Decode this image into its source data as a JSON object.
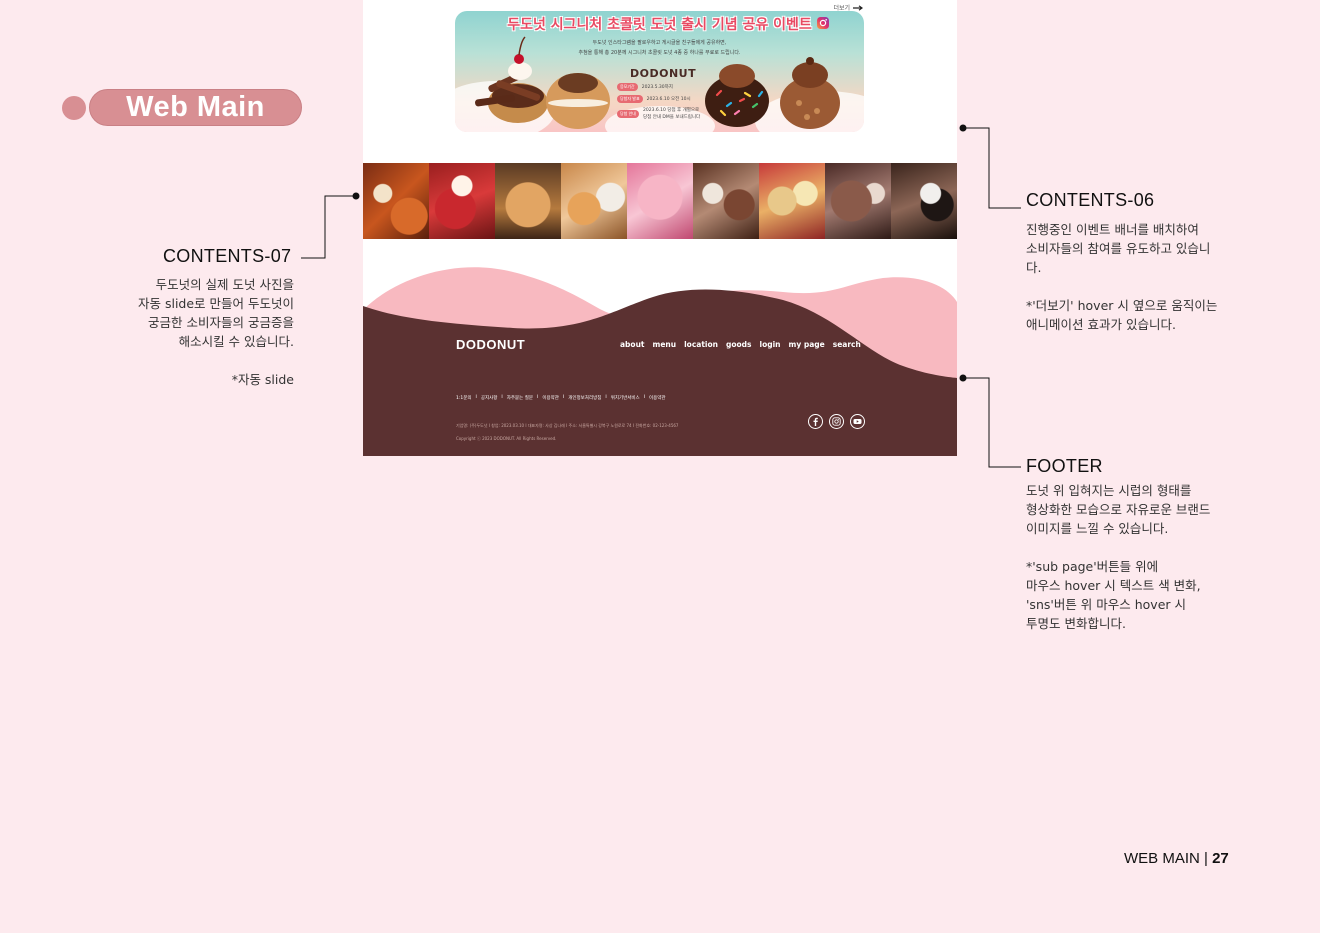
{
  "title": "Web Main",
  "mockup": {
    "event_banner": {
      "more_label": "더보기",
      "title": "두도넛 시그니처 초콜릿 도넛 출시 기념 공유 이벤트",
      "desc_line1": "두도넛 인스타그램을 팔로우하고 게시글을 친구들에게 공유하면,",
      "desc_line2": "추첨을 통해 총 20분께 시그니처 초콜릿 도넛 4종 중 하나를 무료로 드립니다.",
      "brand": "DODONUT",
      "info": [
        {
          "tag": "응모기간",
          "text": "2023.5.30까지"
        },
        {
          "tag": "당첨자 발표",
          "text": "2023.6.10 오전 10시"
        },
        {
          "tag": "당첨 안내",
          "text": "2023.6.10 당첨 후 개별으로 당첨 안내 DM을 보내드립니다"
        }
      ]
    },
    "footer": {
      "logo": "DODONUT",
      "nav": [
        "about",
        "menu",
        "location",
        "goods",
        "login",
        "my page",
        "search"
      ],
      "links": [
        "1:1문의",
        "I",
        "공지사항",
        "I",
        "자주묻는 질문",
        "I",
        "이용약관",
        "I",
        "개인정보처리방침",
        "I",
        "위치기반서비스",
        "I",
        "이용약관"
      ],
      "info": "기업명: (주)두도넛 I 창업: 2023.03.10 I 대표자명: 사상 김나래 I 주소: 서울특별시 강북구 노원로로 74 I 전화번호: 02-123-4567",
      "copyright": "Copyright ⓒ 2023 DODONUT. All Rights Reserved.",
      "sns": [
        "facebook-icon",
        "instagram-icon",
        "youtube-icon"
      ]
    },
    "colors": {
      "footer_brown": "#5b3131",
      "wave_pink": "#f8b9c0",
      "accent": "#d88f93"
    }
  },
  "annotations": {
    "contents07": {
      "title": "CONTENTS-07",
      "text": "두도넛의 실제 도넛 사진을\n자동 slide로 만들어 두도넛이\n궁금한 소비자들의 궁금증을\n해소시킬 수 있습니다.\n\n*자동 slide"
    },
    "contents06": {
      "title": "CONTENTS-06",
      "text": "진행중인 이벤트 배너를 배치하여\n소비자들의 참여를 유도하고 있습니\n다.\n\n*'더보기' hover 시 옆으로 움직이는\n애니메이션 효과가 있습니다."
    },
    "footer": {
      "title": "FOOTER",
      "text": "도넛 위 입혀지는 시럽의 형태를\n형상화한 모습으로 자유로운 브랜드\n이미지를 느낄 수 있습니다.\n\n*'sub page'버튼들 위에\n마우스 hover 시 텍스트 색 변화,\n'sns'버튼 위 마우스 hover 시\n 투명도 변화합니다."
    }
  },
  "page": {
    "section": "WEB MAIN",
    "number": "27"
  }
}
